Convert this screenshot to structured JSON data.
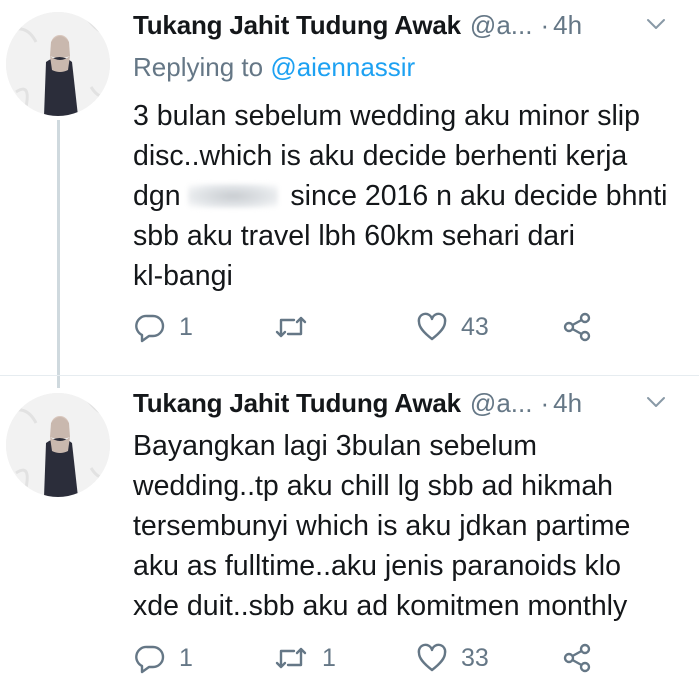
{
  "tweets": [
    {
      "author_name": "Tukang Jahit Tudung Awak",
      "author_handle": "@a...",
      "separator": "·",
      "time": "4h",
      "reply_prefix": "Replying to ",
      "reply_mention": "@aiennassir",
      "text_lines": [
        "3 bulan sebelum wedding aku minor slip",
        "disc..which is aku decide berhenti kerja",
        "dgn",
        "since 2016 n aku decide bhnti",
        "sbb aku travel lbh 60km sehari dari",
        "kl-bangi"
      ],
      "reply_count": "1",
      "retweet_count": "",
      "like_count": "43"
    },
    {
      "author_name": "Tukang Jahit Tudung Awak",
      "author_handle": "@a...",
      "separator": "·",
      "time": "4h",
      "text_lines": [
        "Bayangkan lagi 3bulan sebelum",
        "wedding..tp aku chill lg sbb ad hikmah",
        "tersembunyi which is aku jdkan partime",
        "aku as fulltime..aku jenis paranoids klo",
        "xde duit..sbb aku ad komitmen monthly"
      ],
      "reply_count": "1",
      "retweet_count": "1",
      "like_count": "33"
    }
  ],
  "colors": {
    "text": "#14171a",
    "secondary": "#657786",
    "link": "#1da1f2",
    "thread_line": "#cfd9de"
  },
  "icons": [
    "avatar",
    "chevron-down-icon",
    "reply-icon",
    "retweet-icon",
    "like-icon",
    "share-icon"
  ]
}
